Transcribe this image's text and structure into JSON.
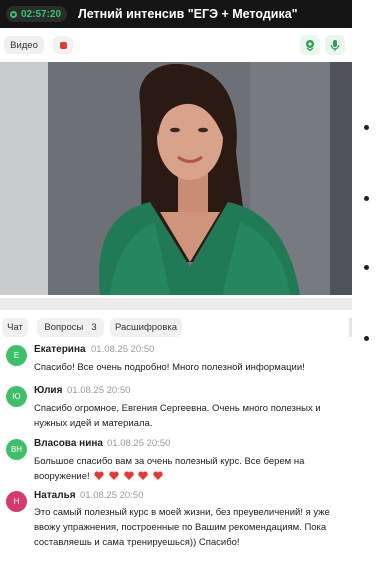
{
  "header": {
    "timer": "02:57:20",
    "title": "Летний интенсив \"ЕГЭ + Методика\""
  },
  "toolbar": {
    "video_label": "Видео"
  },
  "tabs": [
    {
      "label": "Чат",
      "count": ""
    },
    {
      "label": "Вопросы",
      "count": "3"
    },
    {
      "label": "Расшифровка",
      "count": ""
    }
  ],
  "messages": [
    {
      "initials": "Е",
      "name": "Екатерина",
      "time": "01.08.25 20:50",
      "text": "Спасибо! Все очень подробно! Много полезной информации!",
      "color": "#3fbf6a"
    },
    {
      "initials": "Ю",
      "name": "Юлия",
      "time": "01.08.25 20:50",
      "text": "Спасибо огромное, Евгения Сергеевна. Очень много полезных и нужных идей и материала.",
      "color": "#3fbf6a"
    },
    {
      "initials": "ВН",
      "name": "Власова нина",
      "time": "01.08.25 20:50",
      "text": "Большое спасибо вам за очень полезный курс. Все берем на вооружение!",
      "hearts": 5,
      "color": "#3fbf6a"
    },
    {
      "initials": "Н",
      "name": "Наталья",
      "time": "01.08.25 20:50",
      "text": "Это самый полезный курс в моей жизни, без преувеличений! я уже ввожу упражнения, построенные по Вашим рекомендациям. Пока составляешь и сама тренируешься)) Спасибо!",
      "color": "#d63a6a"
    }
  ],
  "colors": {
    "accent_green": "#35c46a",
    "record_red": "#e53935",
    "heart_red": "#e53935"
  }
}
